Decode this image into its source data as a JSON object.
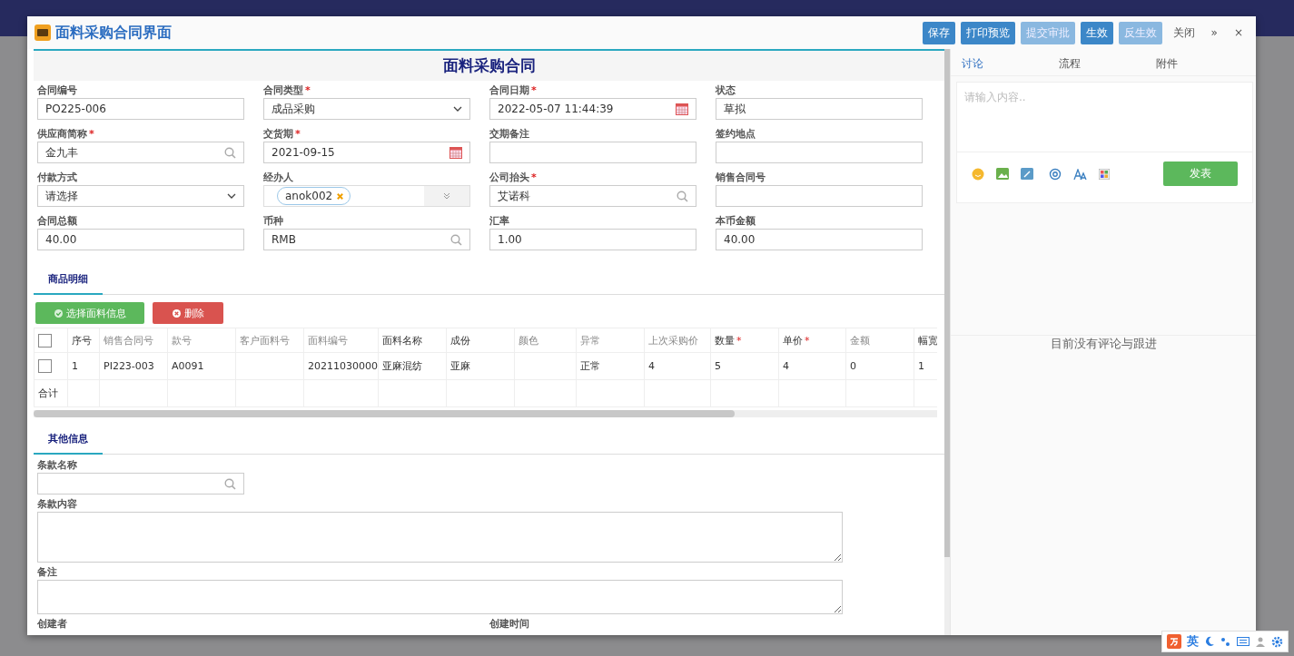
{
  "window": {
    "title": "面料采购合同界面"
  },
  "toolbar": [
    {
      "label": "保存",
      "kind": "primary",
      "disabled": false
    },
    {
      "label": "打印预览",
      "kind": "primary",
      "disabled": false
    },
    {
      "label": "提交审批",
      "kind": "primary",
      "disabled": true
    },
    {
      "label": "生效",
      "kind": "primary",
      "disabled": false
    },
    {
      "label": "反生效",
      "kind": "primary",
      "disabled": true
    },
    {
      "label": "关闭",
      "kind": "plain"
    },
    {
      "label": "»",
      "kind": "plain"
    },
    {
      "label": "×",
      "kind": "plain"
    }
  ],
  "required_mark": "*",
  "form": {
    "title": "面料采购合同",
    "fields": [
      {
        "label": "合同编号",
        "required": false,
        "kind": "text",
        "value": "PO225-006"
      },
      {
        "label": "合同类型",
        "required": true,
        "kind": "select",
        "value": "成品采购"
      },
      {
        "label": "合同日期",
        "required": true,
        "kind": "date",
        "value": "2022-05-07 11:44:39"
      },
      {
        "label": "状态",
        "required": false,
        "kind": "text",
        "value": "草拟"
      },
      {
        "label": "供应商简称",
        "required": true,
        "kind": "search",
        "value": "金九丰"
      },
      {
        "label": "交货期",
        "required": true,
        "kind": "date",
        "value": "2021-09-15"
      },
      {
        "label": "交期备注",
        "required": false,
        "kind": "text"
      },
      {
        "label": "签约地点",
        "required": false,
        "kind": "text"
      },
      {
        "label": "付款方式",
        "required": false,
        "kind": "select",
        "value": "请选择"
      },
      {
        "label": "经办人",
        "required": false,
        "kind": "tags",
        "value": "anok002"
      },
      {
        "label": "公司抬头",
        "required": true,
        "kind": "search",
        "value": "艾诺科"
      },
      {
        "label": "销售合同号",
        "required": false,
        "kind": "text"
      },
      {
        "label": "合同总额",
        "required": false,
        "kind": "text",
        "value": "40.00"
      },
      {
        "label": "币种",
        "required": false,
        "kind": "search",
        "value": "RMB"
      },
      {
        "label": "汇率",
        "required": false,
        "kind": "text",
        "value": "1.00"
      },
      {
        "label": "本币金额",
        "required": false,
        "kind": "text",
        "value": "40.00"
      }
    ]
  },
  "detail": {
    "tab": "商品明细",
    "buttons": [
      {
        "label": "选择面料信息",
        "kind": "add"
      },
      {
        "label": "删除",
        "kind": "delete"
      }
    ],
    "select_all_checked": false,
    "columns": [
      {
        "label": "序号",
        "required": false,
        "bold": true
      },
      {
        "label": "销售合同号",
        "required": false,
        "bold": false
      },
      {
        "label": "款号",
        "required": false,
        "bold": false
      },
      {
        "label": "客户面料号",
        "required": false,
        "bold": false
      },
      {
        "label": "面料编号",
        "required": false,
        "bold": false
      },
      {
        "label": "面料名称",
        "required": false,
        "bold": true
      },
      {
        "label": "成份",
        "required": false,
        "bold": true
      },
      {
        "label": "颜色",
        "required": false,
        "bold": false
      },
      {
        "label": "异常",
        "required": false,
        "bold": false
      },
      {
        "label": "上次采购价",
        "required": false,
        "bold": false
      },
      {
        "label": "数量",
        "required": true,
        "bold": true
      },
      {
        "label": "单价",
        "required": true,
        "bold": true
      },
      {
        "label": "金额",
        "required": false,
        "bold": false
      },
      {
        "label": "幅宽",
        "required": false,
        "bold": true
      }
    ],
    "rows": [
      {
        "checked": false,
        "cells": [
          "1",
          "PI223-003",
          "A0091",
          "",
          "20211030000",
          "亚麻混纺",
          "亚麻",
          "",
          "正常",
          "4",
          "5",
          "4",
          "0",
          "1"
        ]
      }
    ],
    "total_label": "合计"
  },
  "other": {
    "tab": "其他信息",
    "clause_name": {
      "label": "条款名称"
    },
    "clause_content": {
      "label": "条款内容"
    },
    "remark": {
      "label": "备注"
    },
    "footer_labels": [
      "创建者",
      "创建时间"
    ]
  },
  "side": {
    "tabs": [
      {
        "label": "讨论",
        "selected": true
      },
      {
        "label": "流程",
        "selected": false
      },
      {
        "label": "附件",
        "selected": false
      }
    ],
    "comment": {
      "placeholder": "请输入内容.."
    },
    "post_button": "发表",
    "empty": "目前没有评论与跟进"
  },
  "ime": {
    "label": "英"
  }
}
